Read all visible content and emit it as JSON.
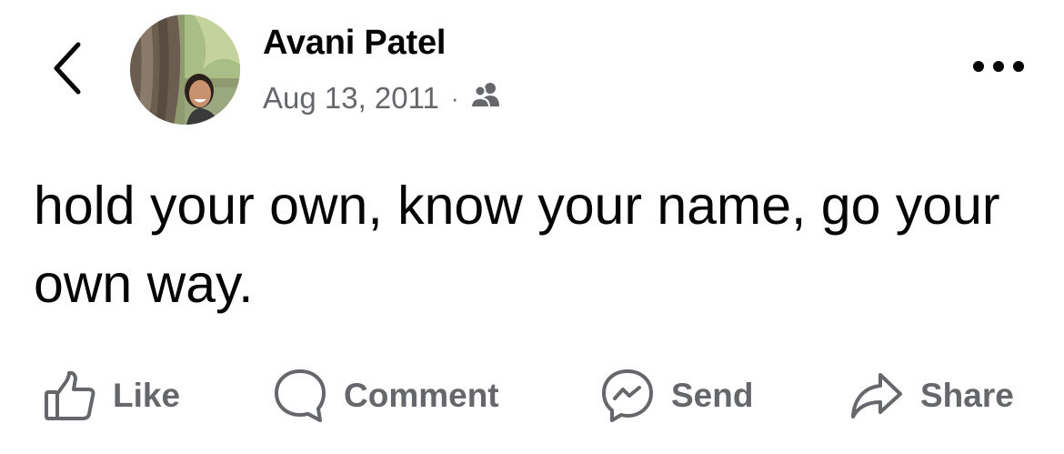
{
  "header": {
    "back_icon": "chevron-left-icon",
    "avatar_icon": "profile-photo",
    "author_name": "Avani Patel",
    "date": "Aug 13, 2011",
    "separator": "·",
    "audience_icon": "friends-icon",
    "more_icon": "more-horizontal-icon"
  },
  "post": {
    "text": "hold your own, know your name, go your own way."
  },
  "actions": [
    {
      "label": "Like",
      "icon": "thumbs-up-icon"
    },
    {
      "label": "Comment",
      "icon": "comment-bubble-icon"
    },
    {
      "label": "Send",
      "icon": "messenger-icon"
    },
    {
      "label": "Share",
      "icon": "share-arrow-icon"
    }
  ],
  "colors": {
    "text_primary": "#050505",
    "text_secondary": "#65676b",
    "background": "#ffffff"
  }
}
